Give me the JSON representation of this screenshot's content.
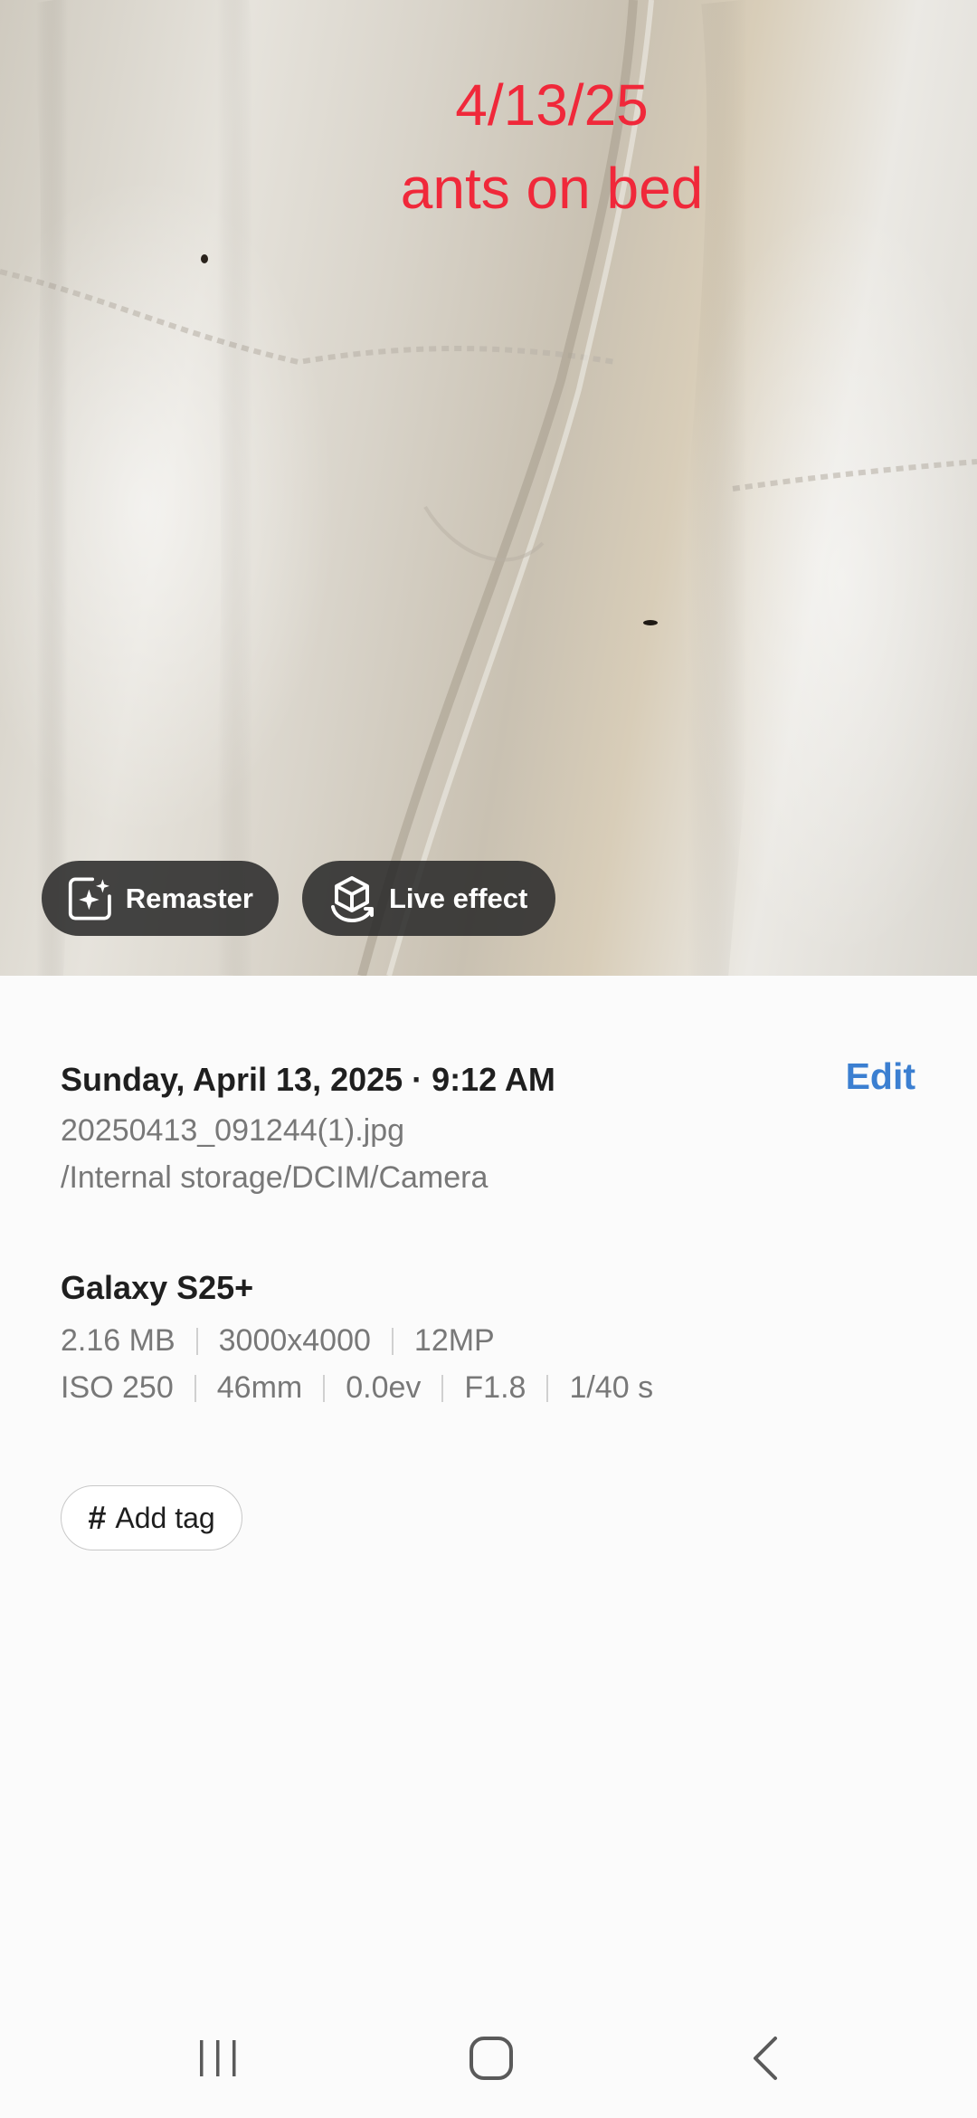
{
  "photo": {
    "overlay_date": "4/13/25",
    "overlay_note": "ants on bed",
    "overlay_color": "#f0283a"
  },
  "actions": {
    "remaster_label": "Remaster",
    "remaster_icon": "sparkle-frame-icon",
    "live_effect_label": "Live effect",
    "live_effect_icon": "cube-rotate-icon"
  },
  "details": {
    "datetime": "Sunday, April 13, 2025 · 9:12 AM",
    "edit_label": "Edit",
    "filename": "20250413_091244(1).jpg",
    "path": "/Internal storage/DCIM/Camera",
    "device": "Galaxy S25+",
    "file_specs": [
      "2.16 MB",
      "3000x4000",
      "12MP"
    ],
    "camera_specs": [
      "ISO 250",
      "46mm",
      "0.0ev",
      "F1.8",
      "1/40 s"
    ],
    "add_tag_label": "Add tag",
    "accent_color": "#3b7fd1"
  },
  "navbar": {
    "recents_icon": "recents-icon",
    "home_icon": "home-icon",
    "back_icon": "back-icon"
  }
}
